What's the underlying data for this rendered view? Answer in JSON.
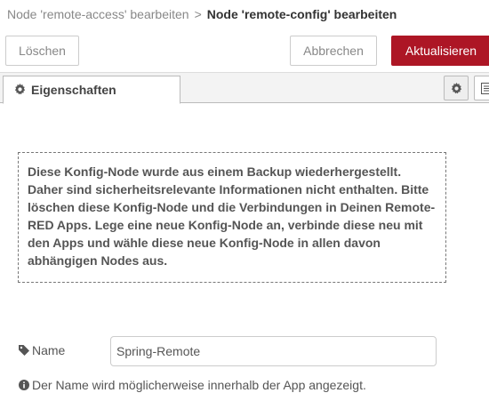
{
  "breadcrumb": {
    "parent": "Node 'remote-access' bearbeiten",
    "separator": ">",
    "current": "Node 'remote-config' bearbeiten"
  },
  "toolbar": {
    "delete_label": "Löschen",
    "cancel_label": "Abbrechen",
    "update_label": "Aktualisieren"
  },
  "tabs": [
    {
      "label": "Eigenschaften",
      "icon": "gear-icon",
      "active": true
    }
  ],
  "notice": {
    "text": "Diese Konfig-Node wurde aus einem Backup wiederhergestellt. Daher sind sicherheitsrelevante Informationen nicht enthalten. Bitte löschen diese Konfig-Node und die Verbindungen in Deinen Remote-RED Apps. Lege eine neue Konfig-Node an, verbinde diese neu mit den Apps und wähle diese neue Konfig-Node in allen davon abhängigen Nodes aus."
  },
  "form": {
    "name_label": "Name",
    "name_value": "Spring-Remote",
    "hint_text": "Der Name wird möglicherweise innerhalb der App angezeigt."
  },
  "colors": {
    "primary_button": "#ad1625",
    "border": "#cccccc",
    "tab_bar": "#f3f3f3"
  }
}
